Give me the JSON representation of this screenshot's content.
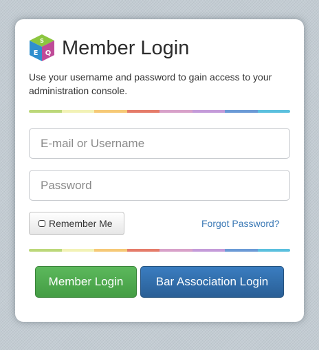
{
  "header": {
    "title": "Member Login",
    "subtitle": "Use your username and password to gain access to your administration console.",
    "logo_letters": [
      "S",
      "E",
      "Q"
    ]
  },
  "form": {
    "username_placeholder": "E-mail or Username",
    "username_value": "",
    "password_placeholder": "Password",
    "password_value": "",
    "remember_label": "Remember Me",
    "remember_checked": false,
    "forgot_label": "Forgot Password?"
  },
  "buttons": {
    "member_login": "Member Login",
    "bar_association_login": "Bar Association Login"
  },
  "colors": {
    "rainbow": [
      "#bcd87a",
      "#f2f2b6",
      "#f6c977",
      "#e57c6a",
      "#d8a1c9",
      "#c49bd9",
      "#6b9ad6",
      "#5bc0de"
    ],
    "member_button": "#4cae4c",
    "bar_button": "#2f6eaa",
    "link": "#3a78b5"
  }
}
